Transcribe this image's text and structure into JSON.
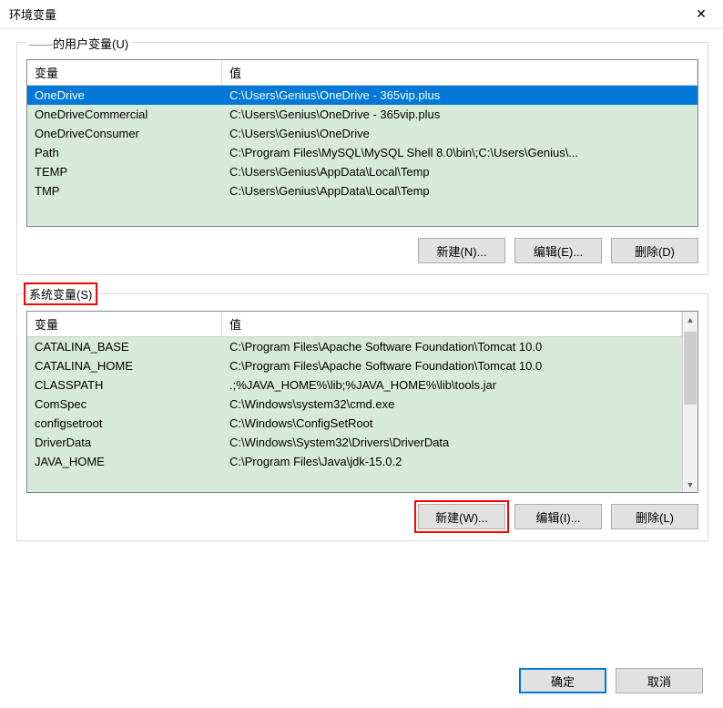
{
  "window": {
    "title": "环境变量",
    "close_glyph": "✕"
  },
  "user_group": {
    "label_prefix_masked": "——",
    "label_suffix": "的用户变量(U)",
    "headers": {
      "variable": "变量",
      "value": "值"
    },
    "rows": [
      {
        "variable": "OneDrive",
        "value": "C:\\Users\\Genius\\OneDrive - 365vip.plus",
        "selected": true
      },
      {
        "variable": "OneDriveCommercial",
        "value": "C:\\Users\\Genius\\OneDrive - 365vip.plus"
      },
      {
        "variable": "OneDriveConsumer",
        "value": "C:\\Users\\Genius\\OneDrive"
      },
      {
        "variable": "Path",
        "value": "C:\\Program Files\\MySQL\\MySQL Shell 8.0\\bin\\;C:\\Users\\Genius\\..."
      },
      {
        "variable": "TEMP",
        "value": "C:\\Users\\Genius\\AppData\\Local\\Temp"
      },
      {
        "variable": "TMP",
        "value": "C:\\Users\\Genius\\AppData\\Local\\Temp"
      }
    ],
    "buttons": {
      "new": "新建(N)...",
      "edit": "编辑(E)...",
      "delete": "删除(D)"
    }
  },
  "system_group": {
    "label": "系统变量(S)",
    "headers": {
      "variable": "变量",
      "value": "值"
    },
    "rows": [
      {
        "variable": "CATALINA_BASE",
        "value": "C:\\Program Files\\Apache Software Foundation\\Tomcat 10.0"
      },
      {
        "variable": "CATALINA_HOME",
        "value": "C:\\Program Files\\Apache Software Foundation\\Tomcat 10.0"
      },
      {
        "variable": "CLASSPATH",
        "value": ".;%JAVA_HOME%\\lib;%JAVA_HOME%\\lib\\tools.jar"
      },
      {
        "variable": "ComSpec",
        "value": "C:\\Windows\\system32\\cmd.exe"
      },
      {
        "variable": "configsetroot",
        "value": "C:\\Windows\\ConfigSetRoot"
      },
      {
        "variable": "DriverData",
        "value": "C:\\Windows\\System32\\Drivers\\DriverData"
      },
      {
        "variable": "JAVA_HOME",
        "value": "C:\\Program Files\\Java\\jdk-15.0.2"
      }
    ],
    "buttons": {
      "new": "新建(W)...",
      "edit": "编辑(I)...",
      "delete": "删除(L)"
    }
  },
  "footer": {
    "ok": "确定",
    "cancel": "取消"
  },
  "scrollbar": {
    "up": "▲",
    "down": "▼"
  }
}
